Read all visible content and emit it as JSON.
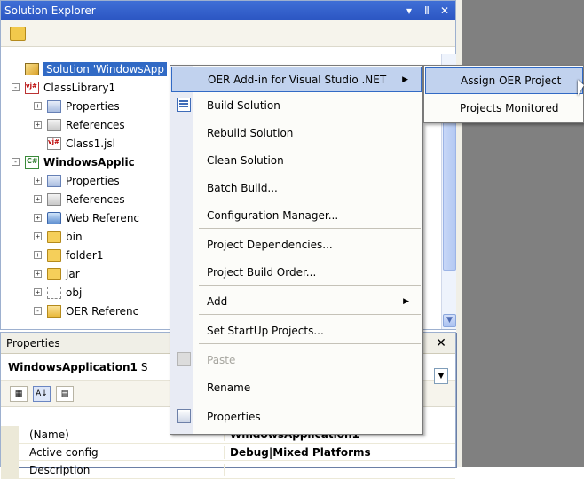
{
  "solution_explorer": {
    "title": "Solution Explorer",
    "title_buttons": [
      "▾",
      "Ⅱ",
      "✕"
    ],
    "tree": [
      {
        "label": "Solution 'WindowsApp",
        "icon": "solution-icon",
        "indent": 0,
        "expander": "none",
        "selected": true,
        "bold": false
      },
      {
        "label": "ClassLibrary1",
        "icon": "vjsharp-project-icon",
        "indent": 0,
        "expander": "-",
        "bold": false
      },
      {
        "label": "Properties",
        "icon": "properties-icon",
        "indent": 1,
        "expander": "+",
        "bold": false
      },
      {
        "label": "References",
        "icon": "references-icon",
        "indent": 1,
        "expander": "+",
        "bold": false
      },
      {
        "label": "Class1.jsl",
        "icon": "vjsharp-file-icon",
        "indent": 1,
        "expander": "none",
        "bold": false
      },
      {
        "label": "WindowsApplic",
        "icon": "csharp-project-icon",
        "indent": 0,
        "expander": "-",
        "bold": true
      },
      {
        "label": "Properties",
        "icon": "properties-icon",
        "indent": 1,
        "expander": "+",
        "bold": false
      },
      {
        "label": "References",
        "icon": "references-icon",
        "indent": 1,
        "expander": "+",
        "bold": false
      },
      {
        "label": "Web Referenc",
        "icon": "web-references-icon",
        "indent": 1,
        "expander": "+",
        "bold": false
      },
      {
        "label": "bin",
        "icon": "folder-icon",
        "indent": 1,
        "expander": "+",
        "bold": false
      },
      {
        "label": "folder1",
        "icon": "folder-icon",
        "indent": 1,
        "expander": "+",
        "bold": false
      },
      {
        "label": "jar",
        "icon": "folder-icon",
        "indent": 1,
        "expander": "+",
        "bold": false
      },
      {
        "label": "obj",
        "icon": "empty-folder-icon",
        "indent": 1,
        "expander": "+",
        "bold": false
      },
      {
        "label": "OER Referenc",
        "icon": "open-folder-icon",
        "indent": 1,
        "expander": "-",
        "bold": false
      }
    ]
  },
  "properties": {
    "title": "Properties",
    "object_name": "WindowsApplication1",
    "object_rest": "S",
    "grid": [
      {
        "name": "(Name)",
        "value": "WindowsApplication1"
      },
      {
        "name": "Active config",
        "value": "Debug|Mixed Platforms"
      },
      {
        "name": "Description",
        "value": ""
      }
    ]
  },
  "context_menu": {
    "items": [
      {
        "label": "OER Add-in for Visual Studio .NET",
        "submenu": true,
        "highlighted": true
      },
      {
        "label": "Build Solution",
        "icon": "build-solution-icon"
      },
      {
        "label": "Rebuild Solution"
      },
      {
        "label": "Clean Solution"
      },
      {
        "label": "Batch Build..."
      },
      {
        "label": "Configuration Manager..."
      },
      {
        "label": "Project Dependencies..."
      },
      {
        "label": "Project Build Order..."
      },
      {
        "label": "Add",
        "submenu": true
      },
      {
        "label": "Set StartUp Projects..."
      },
      {
        "label": "Paste",
        "disabled": true,
        "icon": "paste-icon"
      },
      {
        "label": "Rename"
      },
      {
        "label": "Properties",
        "icon": "properties-icon"
      }
    ]
  },
  "submenu": {
    "items": [
      {
        "label": "Assign OER Project",
        "highlighted": true
      },
      {
        "label": "Projects Monitored"
      }
    ]
  }
}
